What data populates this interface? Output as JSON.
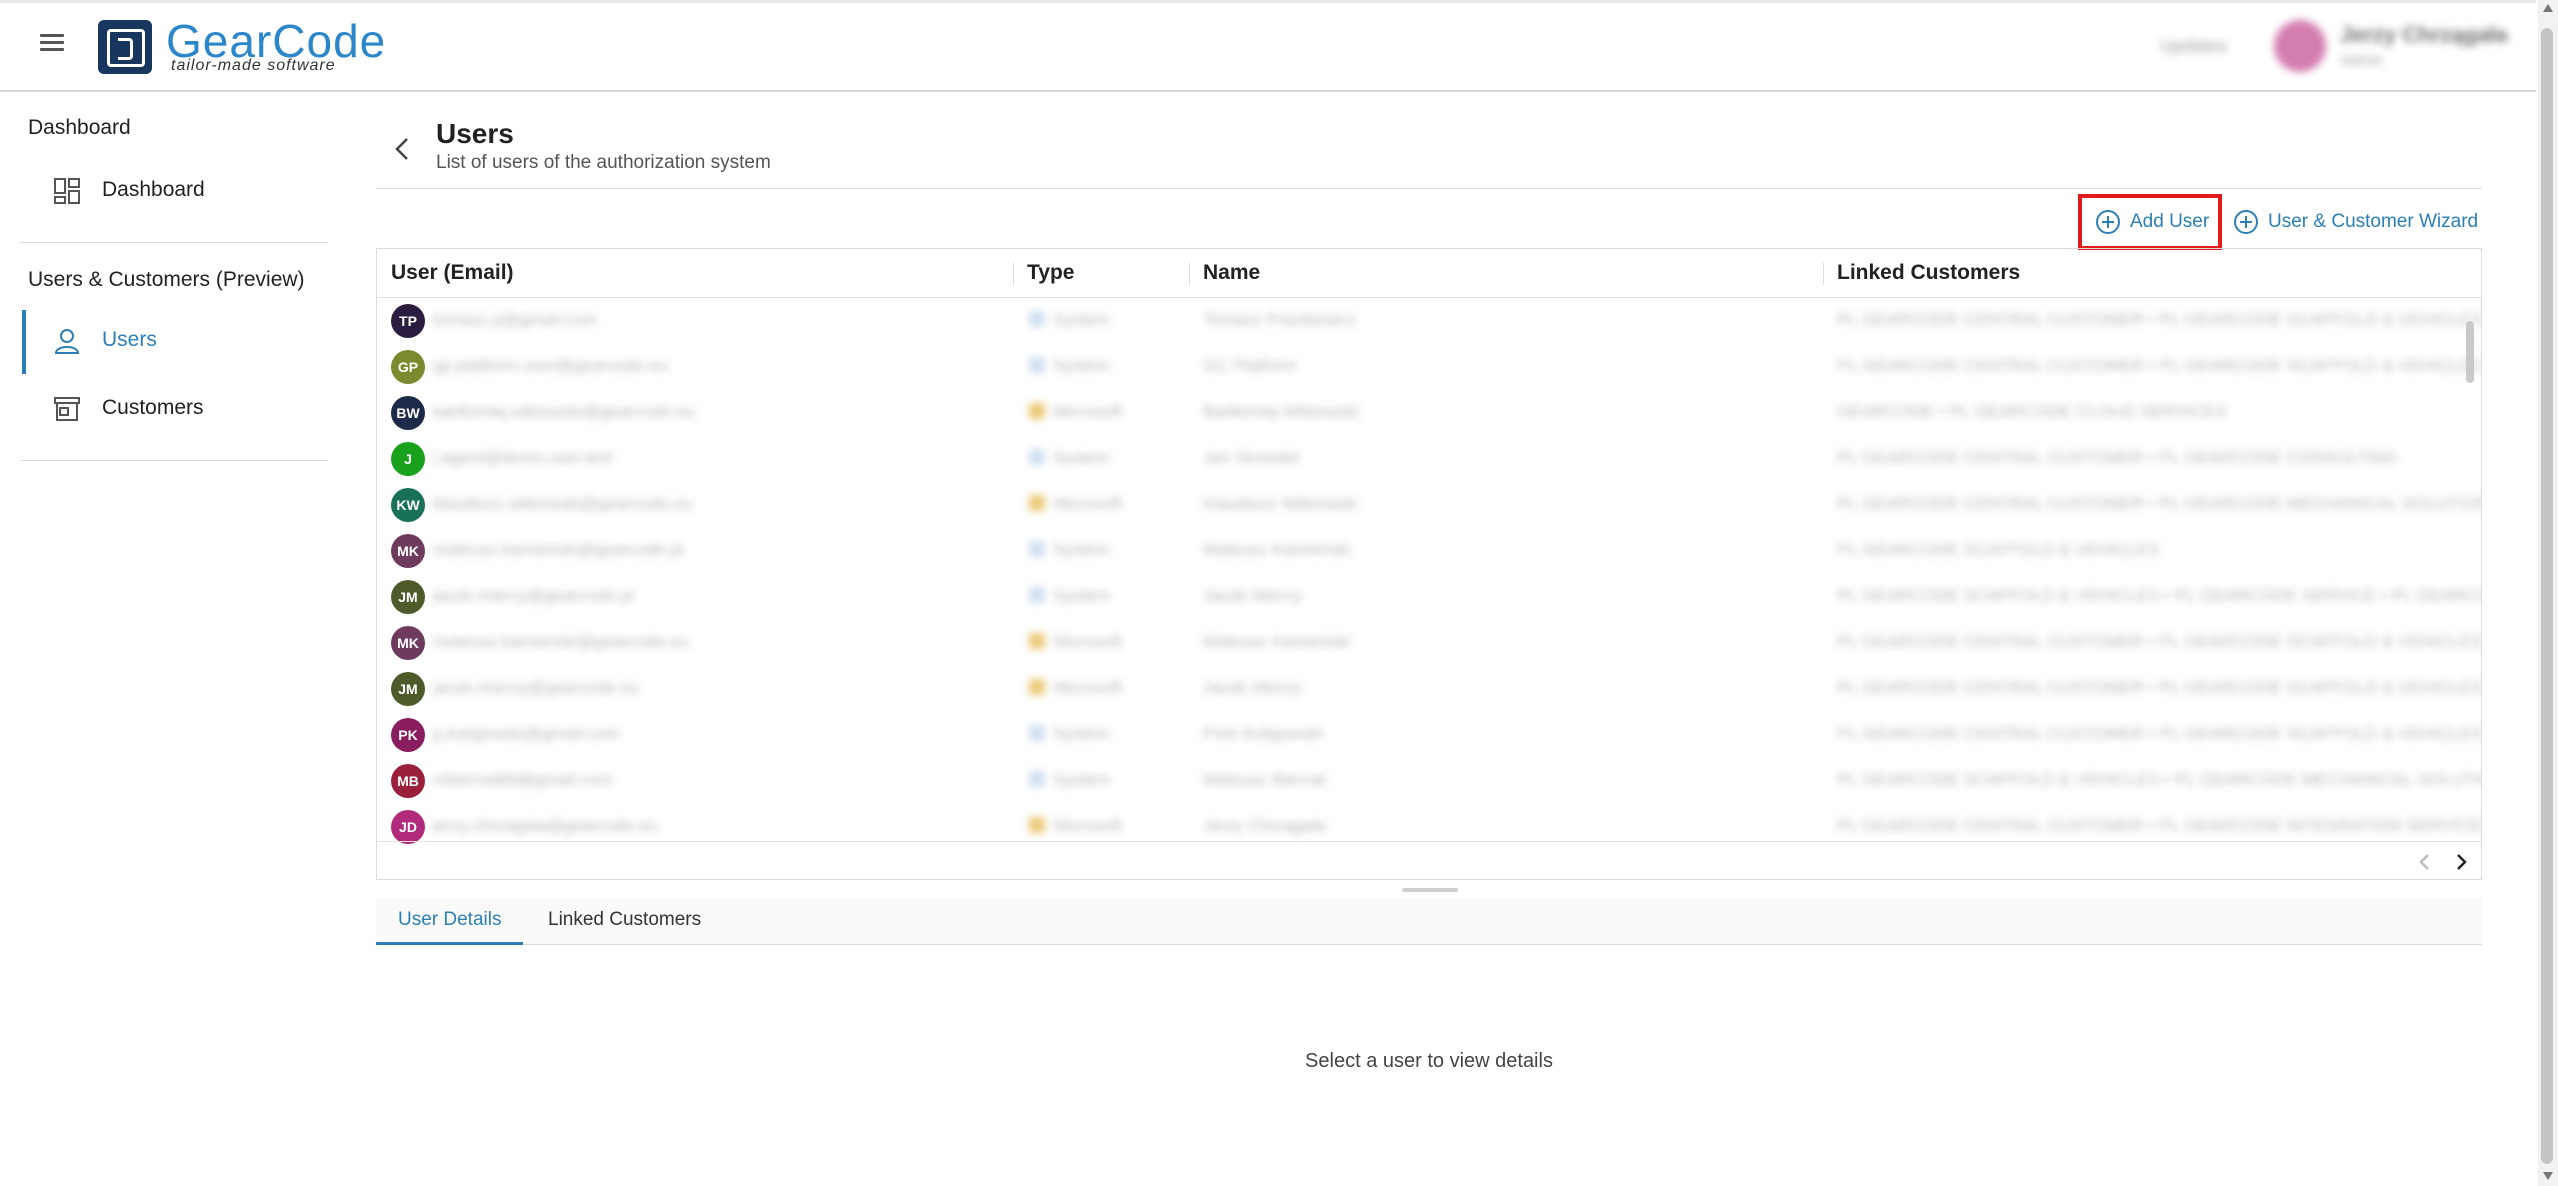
{
  "app": {
    "logo_text": "GearCode",
    "logo_tagline": "tailor-made software",
    "header_link": "Updates",
    "user_name": "Jerzy Chrzągała",
    "user_role": "Admin"
  },
  "sidebar": {
    "section1_heading": "Dashboard",
    "dashboard_label": "Dashboard",
    "section2_heading": "Users & Customers (Preview)",
    "users_label": "Users",
    "customers_label": "Customers"
  },
  "page": {
    "title": "Users",
    "subtitle": "List of users of the authorization system"
  },
  "actions": {
    "add_user": "Add User",
    "wizard": "User & Customer Wizard"
  },
  "table": {
    "columns": [
      "User (Email)",
      "Type",
      "Name",
      "Linked Customers"
    ],
    "rows": [
      {
        "initials": "TP",
        "color": "#2a1d3f",
        "email": "tomasz.p@gmail.com",
        "type": "System",
        "type_color": "#bcd3ea",
        "name": "Tomasz Prazkiewicz",
        "linked": "PL GEARCODE CENTRAL CUSTOMER • PL GEARCODE SCAFFOLD & VEHICLES • GEARCODE"
      },
      {
        "initials": "GP",
        "color": "#7a8a2e",
        "email": "gp.platform.user@gearcode.eu",
        "type": "System",
        "type_color": "#bcd3ea",
        "name": "GC Platform",
        "linked": "PL GEARCODE CENTRAL CUSTOMER • PL GEARCODE SCAFFOLD & VEHICLES • PL GEARCO"
      },
      {
        "initials": "BW",
        "color": "#1e2a4a",
        "email": "bartlomiej.wiktowski@gearcode.eu",
        "type": "Microsoft",
        "type_color": "#e3b23c",
        "name": "Bartłomiej Wiktowski",
        "linked": "GEARCODE • PL GEARCODE CLOUD SERVICES"
      },
      {
        "initials": "J",
        "color": "#19a11d",
        "email": "j.agent@demo.user.test",
        "type": "System",
        "type_color": "#bcd3ea",
        "name": "Jan Stroedel",
        "linked": "PL GEARCODE CENTRAL CUSTOMER • PL GEARCODE CONSULTING"
      },
      {
        "initials": "KW",
        "color": "#19715a",
        "email": "klaudiusz.wiktowski@gearcode.eu",
        "type": "Microsoft",
        "type_color": "#e3b23c",
        "name": "Klaudiusz Wiktowski",
        "linked": "PL GEARCODE CENTRAL CUSTOMER • PL GEARCODE MECHANICAL SOLUTIONS"
      },
      {
        "initials": "MK",
        "color": "#6e3b5e",
        "email": "mateusz.kamienski@gearcode.pl",
        "type": "System",
        "type_color": "#bcd3ea",
        "name": "Mateusz Kamieński",
        "linked": "PL GEARCODE SCAFFOLD & VEHICLES"
      },
      {
        "initials": "JM",
        "color": "#4e5a2a",
        "email": "jacek.mierzy@gearcode.pl",
        "type": "System",
        "type_color": "#bcd3ea",
        "name": "Jacek Mierzy",
        "linked": "PL GEARCODE SCAFFOLD & VEHICLES • PL GEARCODE SERVICE • PL GEARCODE"
      },
      {
        "initials": "MK",
        "color": "#6e3b5e",
        "email": "mateusz.kamienski@gearcode.eu",
        "type": "Microsoft",
        "type_color": "#e3b23c",
        "name": "Mateusz Kamieński",
        "linked": "PL GEARCODE CENTRAL CUSTOMER • PL GEARCODE SCAFFOLD & VEHICLES • PL GEARC"
      },
      {
        "initials": "JM",
        "color": "#4e5a2a",
        "email": "jacek.mierzy@gearcode.eu",
        "type": "Microsoft",
        "type_color": "#e3b23c",
        "name": "Jacek Mierzy",
        "linked": "PL GEARCODE CENTRAL CUSTOMER • PL GEARCODE SCAFFOLD & VEHICLES • PL GEARC"
      },
      {
        "initials": "PK",
        "color": "#8a1d5e",
        "email": "p.kuligowski@gmail.com",
        "type": "System",
        "type_color": "#bcd3ea",
        "name": "Piotr Kuligowski",
        "linked": "PL GEARCODE CENTRAL CUSTOMER • PL GEARCODE SCAFFOLD & VEHICLES • PL GEARC"
      },
      {
        "initials": "MB",
        "color": "#9a1f3a",
        "email": "mbiernat89@gmail.com",
        "type": "System",
        "type_color": "#bcd3ea",
        "name": "Mateusz Biernat",
        "linked": "PL GEARCODE SCAFFOLD & VEHICLES • PL GEARCODE MECHANICAL SOLUTIONS"
      },
      {
        "initials": "JD",
        "color": "#b02b7c",
        "email": "jerzy.chrzagala@gearcode.eu",
        "type": "Microsoft",
        "type_color": "#e3b23c",
        "name": "Jerzy Chrzągała",
        "linked": "PL GEARCODE CENTRAL CUSTOMER • PL GEARCODE INTEGRATION SERVICES"
      }
    ]
  },
  "tabs": {
    "details": "User Details",
    "linked": "Linked Customers"
  },
  "empty_message": "Select a user to view details",
  "colors": {
    "accent": "#2b7fb6",
    "highlight": "#e11a1a",
    "logo_dark": "#17375e",
    "logo_blue": "#2b87c9"
  }
}
